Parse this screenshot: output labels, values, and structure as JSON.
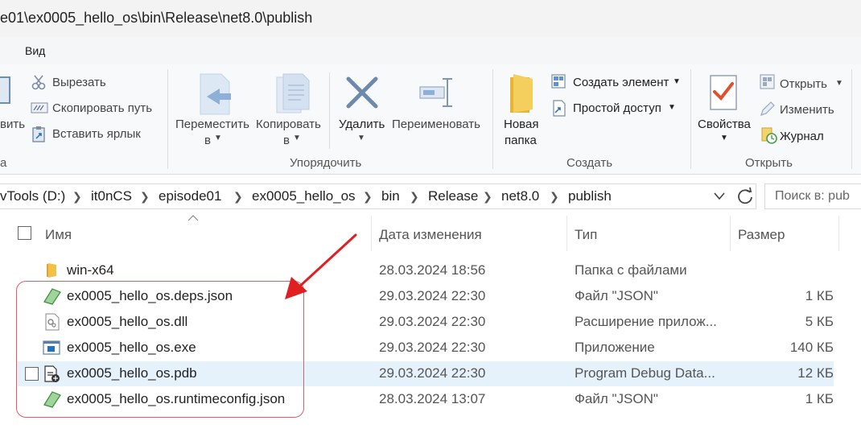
{
  "window": {
    "title": "e01\\ex0005_hello_os\\bin\\Release\\net8.0\\publish"
  },
  "menu": {
    "view": "Вид"
  },
  "ribbon": {
    "clipboard": {
      "paste_partial": "вить",
      "cut": "Вырезать",
      "copy_path": "Скопировать путь",
      "paste_shortcut": "Вставить ярлык",
      "group_partial": "а"
    },
    "organize": {
      "move_line1": "Переместить",
      "move_line2": "в",
      "copy_line1": "Копировать",
      "copy_line2": "в",
      "delete": "Удалить",
      "rename": "Переименовать",
      "label": "Упорядочить"
    },
    "create": {
      "new_folder_line1": "Новая",
      "new_folder_line2": "папка",
      "new_item": "Создать элемент",
      "easy_access": "Простой доступ",
      "label": "Создать"
    },
    "open": {
      "properties": "Свойства",
      "open": "Открыть",
      "edit": "Изменить",
      "history": "Журнал",
      "label": "Открыть"
    }
  },
  "address": {
    "crumbs": [
      "vTools (D:)",
      "it0nCS",
      "episode01",
      "ex0005_hello_os",
      "bin",
      "Release",
      "net8.0",
      "publish"
    ],
    "search_placeholder": "Поиск в: pub"
  },
  "columns": {
    "name": "Имя",
    "date": "Дата изменения",
    "type": "Тип",
    "size": "Размер"
  },
  "files": [
    {
      "name": "win-x64",
      "date": "28.03.2024 18:56",
      "type": "Папка с файлами",
      "size": "",
      "icon": "folder-icon"
    },
    {
      "name": "ex0005_hello_os.deps.json",
      "date": "29.03.2024 22:30",
      "type": "Файл \"JSON\"",
      "size": "1 КБ",
      "icon": "json-file-icon"
    },
    {
      "name": "ex0005_hello_os.dll",
      "date": "29.03.2024 22:30",
      "type": "Расширение прилож...",
      "size": "5 КБ",
      "icon": "dll-file-icon"
    },
    {
      "name": "ex0005_hello_os.exe",
      "date": "29.03.2024 22:30",
      "type": "Приложение",
      "size": "140 КБ",
      "icon": "exe-file-icon"
    },
    {
      "name": "ex0005_hello_os.pdb",
      "date": "29.03.2024 22:30",
      "type": "Program Debug Data...",
      "size": "12 КБ",
      "icon": "pdb-file-icon"
    },
    {
      "name": "ex0005_hello_os.runtimeconfig.json",
      "date": "28.03.2024 13:07",
      "type": "Файл \"JSON\"",
      "size": "1 КБ",
      "icon": "json-file-icon"
    }
  ],
  "colors": {
    "selection": "#e5f1fb",
    "annotation": "#e02020",
    "folder": "#f2c14a"
  }
}
